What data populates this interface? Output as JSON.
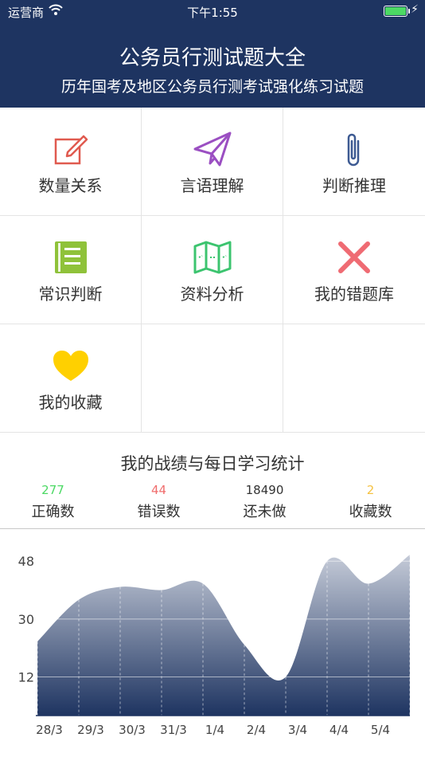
{
  "status_bar": {
    "carrier": "运营商",
    "time": "下午1:55",
    "battery_level": 1.0
  },
  "header": {
    "title": "公务员行测试题大全",
    "subtitle": "历年国考及地区公务员行测考试强化练习试题"
  },
  "categories": [
    {
      "label": "数量关系",
      "icon": "edit-icon",
      "color": "#e05a4f"
    },
    {
      "label": "言语理解",
      "icon": "paper-plane-icon",
      "color": "#9b4fc2"
    },
    {
      "label": "判断推理",
      "icon": "paperclip-icon",
      "color": "#3d5a92"
    },
    {
      "label": "常识判断",
      "icon": "notebook-icon",
      "color": "#8fc23a"
    },
    {
      "label": "资料分析",
      "icon": "map-icon",
      "color": "#3cc46f"
    },
    {
      "label": "我的错题库",
      "icon": "close-x-icon",
      "color": "#ef6b73"
    },
    {
      "label": "我的收藏",
      "icon": "heart-icon",
      "color": "#ffd000"
    }
  ],
  "stats": {
    "title": "我的战绩与每日学习统计",
    "items": [
      {
        "value": "277",
        "label": "正确数",
        "color": "#4cd964"
      },
      {
        "value": "44",
        "label": "错误数",
        "color": "#f06d6d"
      },
      {
        "value": "18490",
        "label": "还未做",
        "color": "#333333"
      },
      {
        "value": "2",
        "label": "收藏数",
        "color": "#f5c242"
      }
    ]
  },
  "chart_data": {
    "type": "area",
    "categories": [
      "28/3",
      "29/3",
      "30/3",
      "31/3",
      "1/4",
      "2/4",
      "3/4",
      "4/4",
      "5/4",
      ""
    ],
    "values": [
      23,
      36,
      40,
      39,
      41,
      22,
      12,
      48,
      41,
      50
    ],
    "ylim": [
      0,
      53
    ],
    "yticks": [
      12,
      30,
      48
    ],
    "grid": true,
    "colors": {
      "top": "#c5cbd8",
      "bottom": "#1e3461"
    }
  }
}
